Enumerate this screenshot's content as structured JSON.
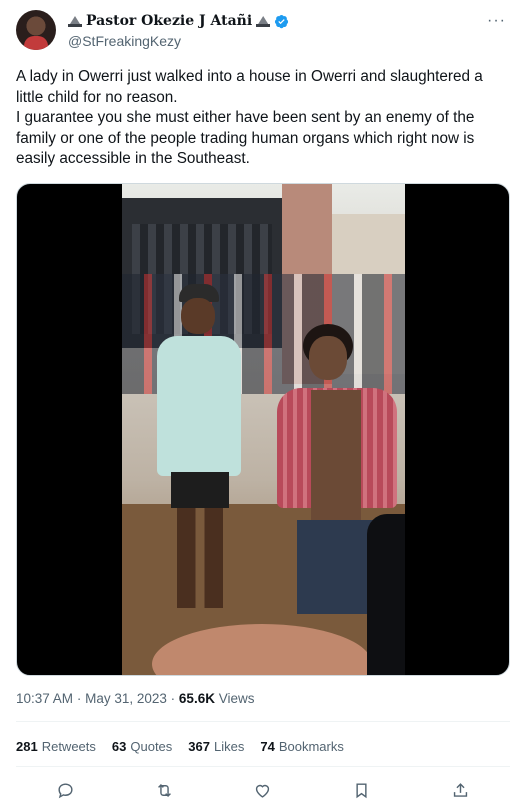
{
  "author": {
    "display_name": "Pastor Okezie J Atañi",
    "handle": "@StFreakingKezy",
    "verified": true,
    "name_emoji": "monument-icon"
  },
  "more_label": "···",
  "tweet": {
    "paragraph_1": "A lady in Owerri just walked into a house in Owerri and slaughtered a little child for no reason.",
    "paragraph_2": "I guarantee you she must either have been sent by an enemy of the family or one of the people trading human organs which right now is easily accessible in the Southeast."
  },
  "meta": {
    "time": "10:37 AM",
    "separator": "·",
    "date": "May 31, 2023",
    "views_count": "65.6K",
    "views_label": "Views"
  },
  "stats": {
    "retweets_count": "281",
    "retweets_label": "Retweets",
    "quotes_count": "63",
    "quotes_label": "Quotes",
    "likes_count": "367",
    "likes_label": "Likes",
    "bookmarks_count": "74",
    "bookmarks_label": "Bookmarks"
  },
  "colors": {
    "text_primary": "#0f1419",
    "text_secondary": "#536471",
    "verified_blue": "#1d9bf0",
    "divider": "#eff3f4"
  },
  "actions": [
    "reply-icon",
    "retweet-icon",
    "like-icon",
    "bookmark-icon",
    "share-icon"
  ]
}
